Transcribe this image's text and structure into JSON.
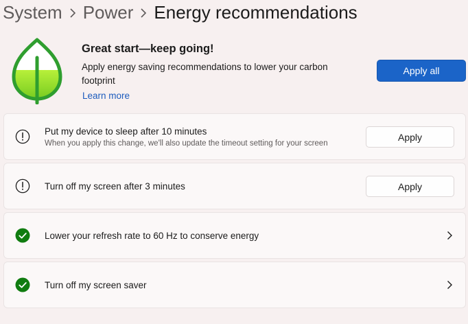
{
  "breadcrumb": {
    "items": [
      "System",
      "Power"
    ],
    "current": "Energy recommendations"
  },
  "hero": {
    "title": "Great start—keep going!",
    "description": "Apply energy saving recommendations to lower your carbon footprint",
    "learn_more": "Learn more",
    "apply_all_label": "Apply all",
    "icon": "leaf-icon"
  },
  "recommendations": [
    {
      "title": "Put my device to sleep after 10 minutes",
      "subtitle": "When you apply this change, we'll also update the timeout setting for your screen",
      "status": "pending",
      "icon": "warning-circle-icon",
      "action_label": "Apply"
    },
    {
      "title": "Turn off my screen after 3 minutes",
      "status": "pending",
      "icon": "warning-circle-icon",
      "action_label": "Apply"
    },
    {
      "title": "Lower your refresh rate to 60 Hz to conserve energy",
      "status": "applied",
      "icon": "check-circle-icon"
    },
    {
      "title": "Turn off my screen saver",
      "status": "applied",
      "icon": "check-circle-icon"
    }
  ],
  "colors": {
    "accent": "#1b64c8",
    "success": "#107c10",
    "link": "#1c5bbd",
    "leaf_outline": "#2f9e2f",
    "leaf_fill": "#7ed321"
  }
}
